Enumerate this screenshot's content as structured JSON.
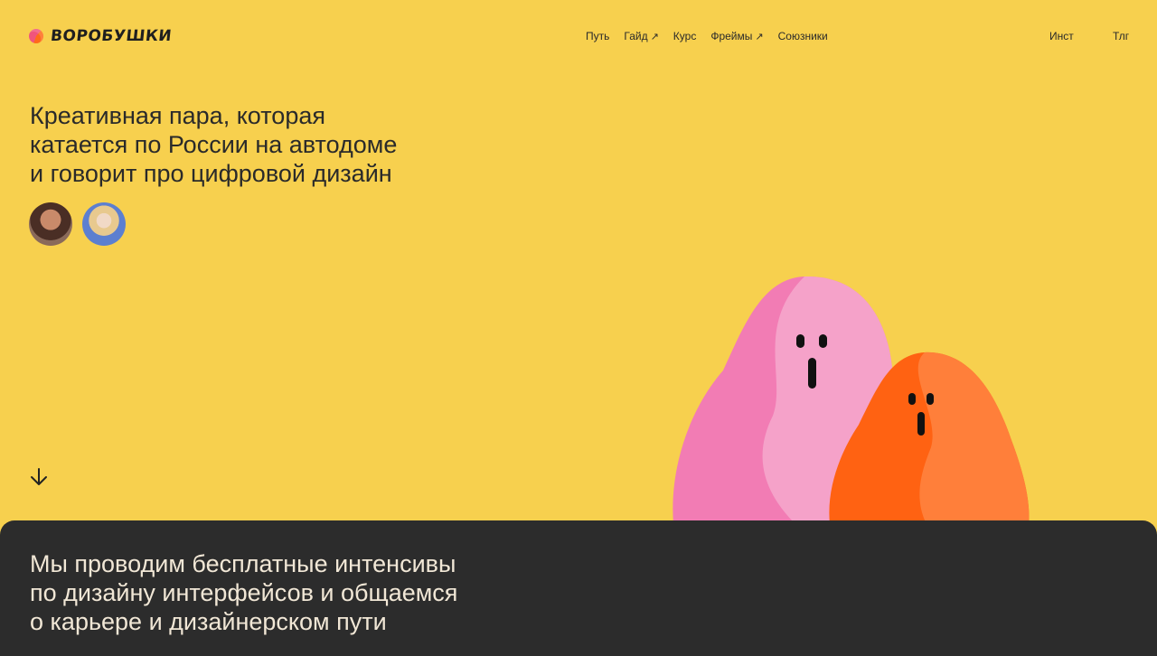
{
  "header": {
    "logo_text": "ВОРОБУШКИ",
    "nav": [
      {
        "label": "Путь",
        "arrow": ""
      },
      {
        "label": "Гайд",
        "arrow": "↗"
      },
      {
        "label": "Курс",
        "arrow": ""
      },
      {
        "label": "Фреймы",
        "arrow": "↗"
      },
      {
        "label": "Союзники",
        "arrow": ""
      }
    ],
    "right_links": [
      "Инст",
      "Тлг"
    ]
  },
  "hero": {
    "title_lines": [
      "Креативная пара, которая",
      "катается по России на автодоме",
      "и говорит про цифровой дизайн"
    ]
  },
  "panel": {
    "text_lines": [
      "Мы проводим бесплатные интенсивы",
      "по дизайну интерфейсов и общаемся",
      "о карьере и дизайнерском пути"
    ]
  },
  "colors": {
    "background": "#F7D04E",
    "panel": "#2C2C2C",
    "panel_text": "#F1E7D6",
    "pink": "#F48BBE",
    "orange": "#FF6B1A"
  },
  "icons": {
    "logo": "logo-mark-icon",
    "external": "arrow-up-right-icon",
    "scroll": "arrow-down-icon"
  }
}
